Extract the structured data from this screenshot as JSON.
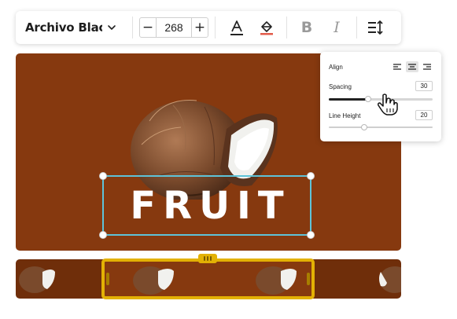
{
  "toolbar": {
    "font_family": "Archivo Black",
    "font_size": "268",
    "decrement_label": "−",
    "increment_label": "+",
    "bold_label": "B",
    "italic_label": "I"
  },
  "canvas": {
    "text": "FRUIT",
    "background_color": "#86390f",
    "selection_color": "#5ec3d8"
  },
  "spacing_panel": {
    "align_label": "Align",
    "align_options": [
      "align-left",
      "align-center",
      "align-right"
    ],
    "align_selected": "align-center",
    "spacing_label": "Spacing",
    "spacing_value": "30",
    "spacing_level": 0.38,
    "line_height_label": "Line Height",
    "line_height_value": "20",
    "line_height_level": 0.34
  },
  "timeline": {
    "clip_color": "#e3b104",
    "track_color": "#6f2e0a"
  }
}
